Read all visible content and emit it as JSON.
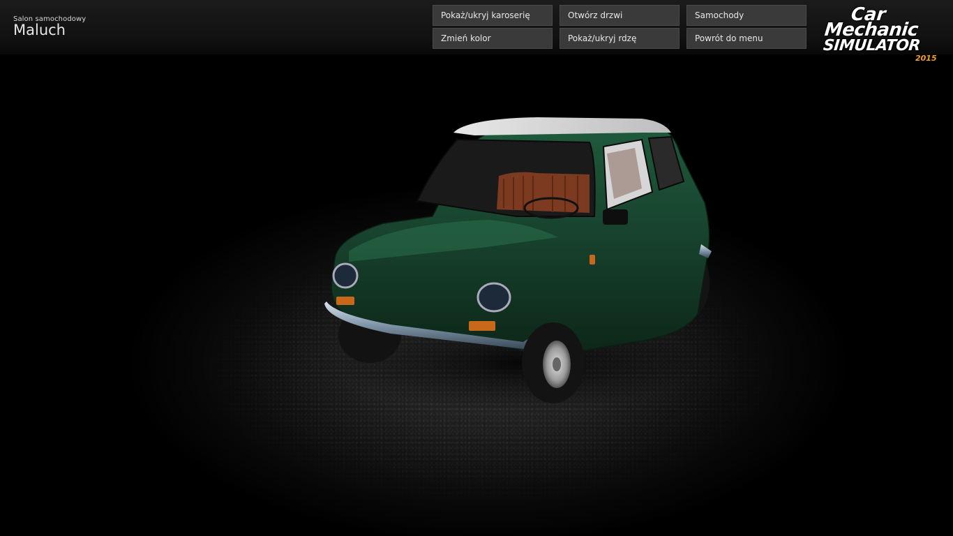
{
  "header": {
    "location_small": "Salon samochodowy",
    "location_title": "Maluch"
  },
  "menu": {
    "toggle_body": "Pokaż/ukryj karoserię",
    "open_doors": "Otwórz drzwi",
    "cars": "Samochody",
    "change_color": "Zmień kolor",
    "toggle_rust": "Pokaż/ukryj rdzę",
    "back_to_menu": "Powrót do menu"
  },
  "logo": {
    "line1": "Car",
    "line2": "Mechanic",
    "line3": "SIMULATOR",
    "year": "2015"
  },
  "colors": {
    "car_body": "#17412c",
    "logo_year": "#f2a21e",
    "button_bg": "#3a3a3a"
  }
}
